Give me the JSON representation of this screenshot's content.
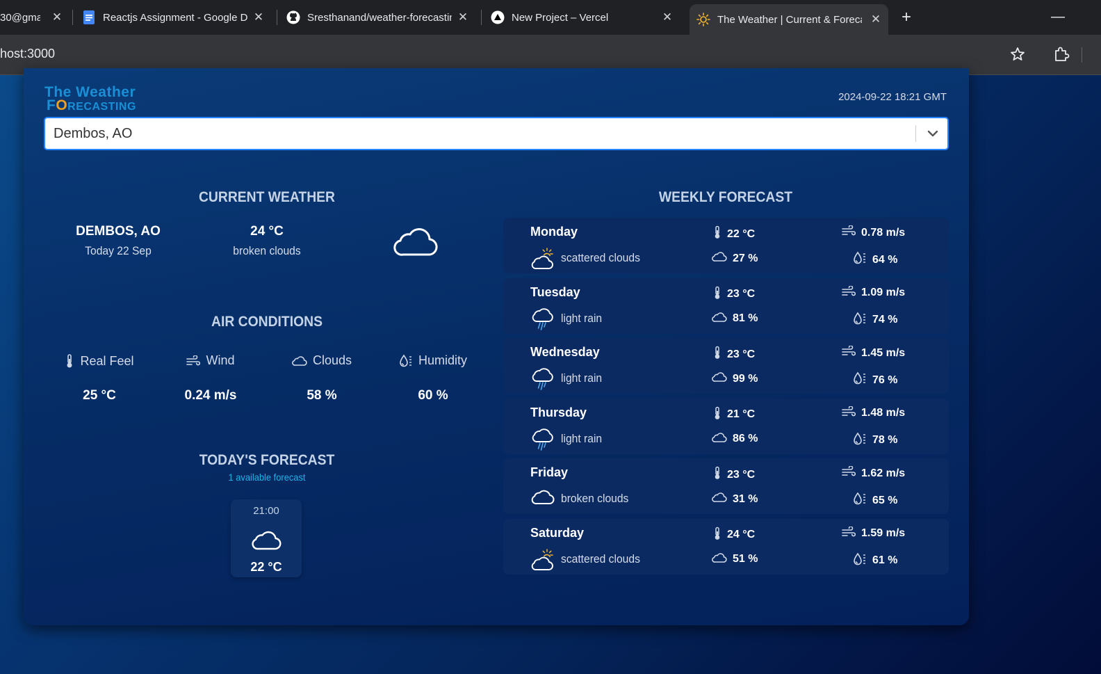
{
  "browser": {
    "tabs": [
      {
        "title": "30@gma",
        "icon": "gmail-icon"
      },
      {
        "title": "Reactjs Assignment - Google Do",
        "icon": "google-docs-icon"
      },
      {
        "title": "Sresthanand/weather-forecastin",
        "icon": "github-icon"
      },
      {
        "title": "New Project – Vercel",
        "icon": "vercel-icon"
      },
      {
        "title": "The Weather | Current & Foreca",
        "icon": "sun-icon",
        "active": true
      }
    ],
    "url": "host:3000"
  },
  "app": {
    "logo": {
      "line1": "The Weather",
      "line2_first": "F",
      "line2_o": "O",
      "line2_rest": "recasting"
    },
    "datetime": "2024-09-22 18:21 GMT",
    "search": {
      "value": "Dembos, AO"
    },
    "colors": {
      "accent": "#1a8fd6",
      "logo_o": "#f0a020",
      "link": "#1fb3e8"
    }
  },
  "current": {
    "title": "CURRENT WEATHER",
    "city": "DEMBOS, AO",
    "date": "Today 22 Sep",
    "temp": "24 °C",
    "description": "broken clouds",
    "icon": "cloud-icon"
  },
  "air": {
    "title": "AIR CONDITIONS",
    "items": [
      {
        "label": "Real Feel",
        "value": "25 °C",
        "icon": "thermometer-icon"
      },
      {
        "label": "Wind",
        "value": "0.24 m/s",
        "icon": "wind-icon"
      },
      {
        "label": "Clouds",
        "value": "58 %",
        "icon": "cloud-icon"
      },
      {
        "label": "Humidity",
        "value": "60 %",
        "icon": "humidity-icon"
      }
    ]
  },
  "today": {
    "title": "TODAY'S FORECAST",
    "count": "1 available forecast",
    "items": [
      {
        "time": "21:00",
        "temp": "22 °C",
        "icon": "cloud-icon"
      }
    ]
  },
  "weekly": {
    "title": "WEEKLY FORECAST",
    "days": [
      {
        "day": "Monday",
        "desc": "scattered clouds",
        "icon": "partly-cloudy-icon",
        "temp": "22 °C",
        "wind": "0.78 m/s",
        "clouds": "27 %",
        "humidity": "64 %"
      },
      {
        "day": "Tuesday",
        "desc": "light rain",
        "icon": "rain-icon",
        "temp": "23 °C",
        "wind": "1.09 m/s",
        "clouds": "81 %",
        "humidity": "74 %"
      },
      {
        "day": "Wednesday",
        "desc": "light rain",
        "icon": "rain-icon",
        "temp": "23 °C",
        "wind": "1.45 m/s",
        "clouds": "99 %",
        "humidity": "76 %"
      },
      {
        "day": "Thursday",
        "desc": "light rain",
        "icon": "rain-icon",
        "temp": "21 °C",
        "wind": "1.48 m/s",
        "clouds": "86 %",
        "humidity": "78 %"
      },
      {
        "day": "Friday",
        "desc": "broken clouds",
        "icon": "cloud-icon",
        "temp": "23 °C",
        "wind": "1.62 m/s",
        "clouds": "31 %",
        "humidity": "65 %"
      },
      {
        "day": "Saturday",
        "desc": "scattered clouds",
        "icon": "partly-cloudy-icon",
        "temp": "24 °C",
        "wind": "1.59 m/s",
        "clouds": "51 %",
        "humidity": "61 %"
      }
    ]
  }
}
